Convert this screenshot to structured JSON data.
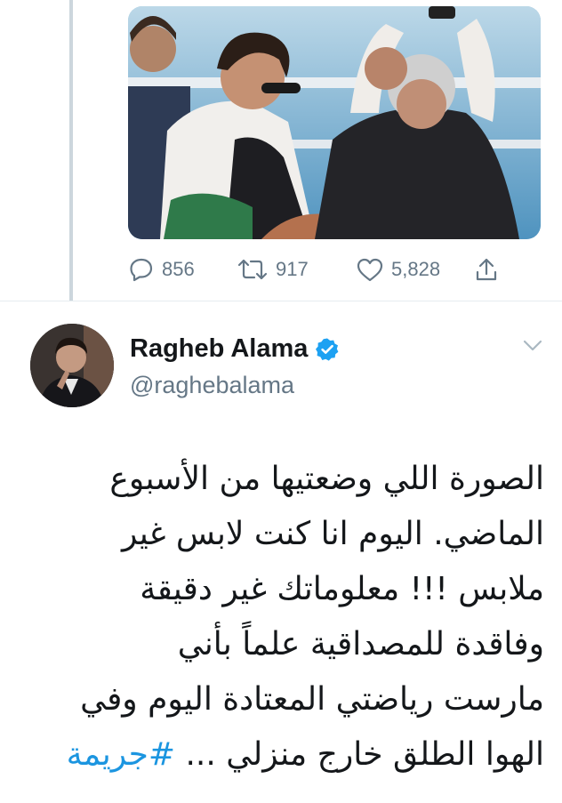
{
  "tweet_actions": {
    "reply_count": "856",
    "retweet_count": "917",
    "like_count": "5,828"
  },
  "author": {
    "name": "Ragheb Alama",
    "handle": "@raghebalama"
  },
  "tweet": {
    "lines": [
      "الصورة اللي وضعتيها من الأسبوع",
      "الماضي. اليوم انا كنت لابس غير",
      "ملابس !!! معلوماتك غير دقيقة",
      "وفاقدة للمصداقية علماً بأني",
      "مارست رياضتي المعتادة اليوم وفي",
      "الهوا الطلق خارج منزلي ..."
    ],
    "hashtag": "#جريمة"
  },
  "colors": {
    "accent": "#1da1f2",
    "link": "#1b95e0",
    "muted": "#657786"
  },
  "icons": [
    "reply-icon",
    "retweet-icon",
    "like-icon",
    "share-icon",
    "verified-badge-icon",
    "chevron-down-icon"
  ]
}
